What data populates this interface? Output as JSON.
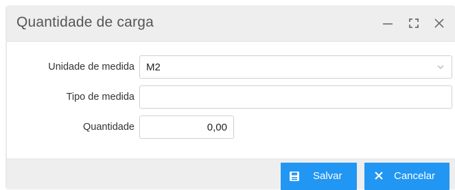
{
  "dialog": {
    "title": "Quantidade de carga",
    "controls": {
      "minimize_icon": "minimize-icon",
      "maximize_icon": "maximize-icon",
      "close_icon": "close-icon"
    }
  },
  "form": {
    "unidade_de_medida": {
      "label": "Unidade de medida",
      "value": "M2"
    },
    "tipo_de_medida": {
      "label": "Tipo de medida",
      "value": ""
    },
    "quantidade": {
      "label": "Quantidade",
      "value": "0,00"
    }
  },
  "footer": {
    "save_label": "Salvar",
    "save_icon": "save-icon",
    "cancel_label": "Cancelar",
    "cancel_icon": "close-icon"
  },
  "colors": {
    "primary_button": "#2196f3",
    "titlebar_bg": "#eeeeee",
    "footer_bg": "#eeeeee"
  }
}
